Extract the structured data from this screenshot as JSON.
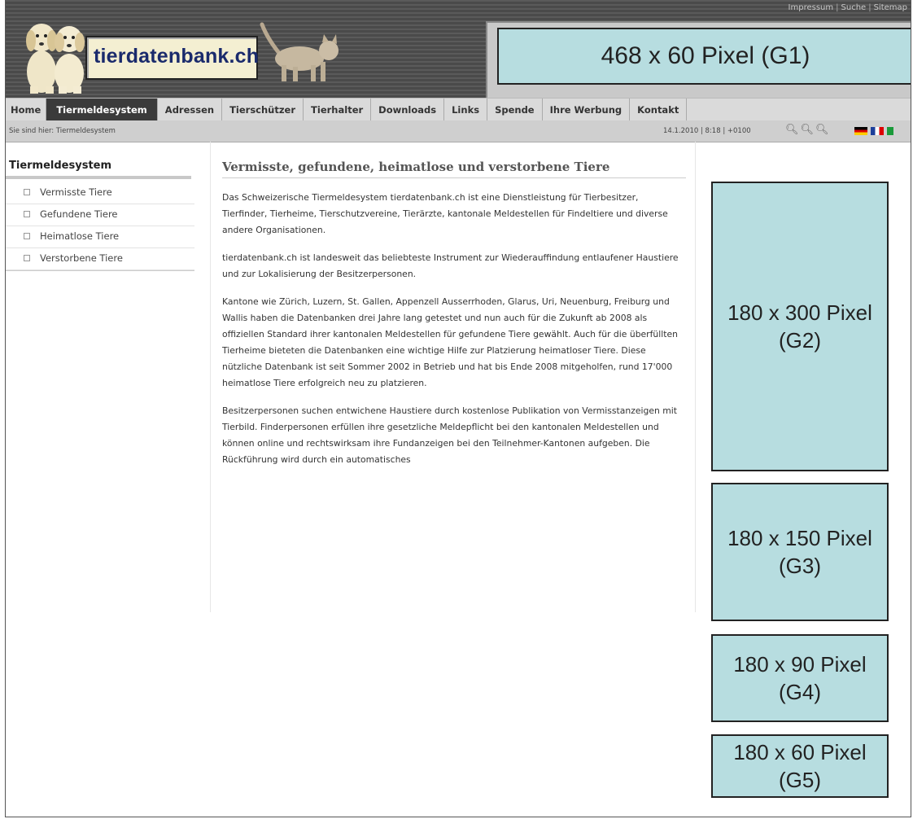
{
  "header": {
    "top_links": [
      "Impressum",
      "Suche",
      "Sitemap"
    ],
    "logo_text": "tierdatenbank.ch",
    "banner_g1": "468 x 60 Pixel (G1)"
  },
  "nav": {
    "items": [
      "Home",
      "Tiermeldesystem",
      "Adressen",
      "Tierschützer",
      "Tierhalter",
      "Downloads",
      "Links",
      "Spende",
      "Ihre Werbung",
      "Kontakt"
    ],
    "active": "Tiermeldesystem"
  },
  "breadcrumb": {
    "text": "Sie sind hier: Tiermeldesystem",
    "datetime": "14.1.2010 | 8:18 | +0100"
  },
  "zoom_icons": [
    "zoom-in-icon",
    "zoom-reset-icon",
    "zoom-out-icon"
  ],
  "languages": [
    "de",
    "fr",
    "it"
  ],
  "sidebar": {
    "title": "Tiermeldesystem",
    "items": [
      "Vermisste Tiere",
      "Gefundene Tiere",
      "Heimatlose Tiere",
      "Verstorbene Tiere"
    ]
  },
  "main": {
    "title": "Vermisste, gefundene, heimatlose und verstorbene Tiere",
    "paragraphs": [
      "Das Schweizerische Tiermeldesystem tierdatenbank.ch ist eine Dienstleistung für Tierbesitzer, Tierfinder, Tierheime, Tierschutzvereine, Tierärzte, kantonale Meldestellen für Findeltiere und diverse andere Organisationen.",
      "tierdatenbank.ch ist landesweit das beliebteste Instrument zur Wiederauffindung entlaufener Haustiere und zur Lokalisierung der Besitzerpersonen.",
      "Kantone wie Zürich, Luzern, St. Gallen, Appenzell Ausserrhoden, Glarus, Uri, Neuenburg, Freiburg und Wallis haben die Datenbanken drei Jahre lang getestet und nun auch für die Zukunft ab 2008 als offiziellen Standard ihrer kantonalen Meldestellen für gefundene Tiere gewählt. Auch für die überfüllten Tierheime bieteten die Datenbanken eine wichtige Hilfe zur Platzierung heimatloser Tiere. Diese nützliche Datenbank ist seit Sommer 2002 in Betrieb und hat bis Ende 2008 mitgeholfen, rund 17'000 heimatlose Tiere erfolgreich neu zu platzieren.",
      "Besitzerpersonen suchen entwichene Haustiere durch kostenlose Publikation von Vermisstanzeigen mit Tierbild. Finderpersonen erfüllen ihre gesetzliche Meldepflicht bei den kantonalen Meldestellen und können online und rechtswirksam ihre Fundanzeigen bei den Teilnehmer-Kantonen aufgeben. Die Rückführung wird durch ein automatisches"
    ]
  },
  "ads": {
    "g2": [
      "180 x 300 Pixel",
      "(G2)"
    ],
    "g3": [
      "180 x 150 Pixel",
      "(G3)"
    ],
    "g4": [
      "180 x 90 Pixel",
      "(G4)"
    ],
    "g5": [
      "180 x 60 Pixel",
      "(G5)"
    ]
  },
  "colors": {
    "ad_fill": "#b7dde0",
    "nav_active": "#3b3b3b",
    "logo_text": "#1a2a6c"
  }
}
